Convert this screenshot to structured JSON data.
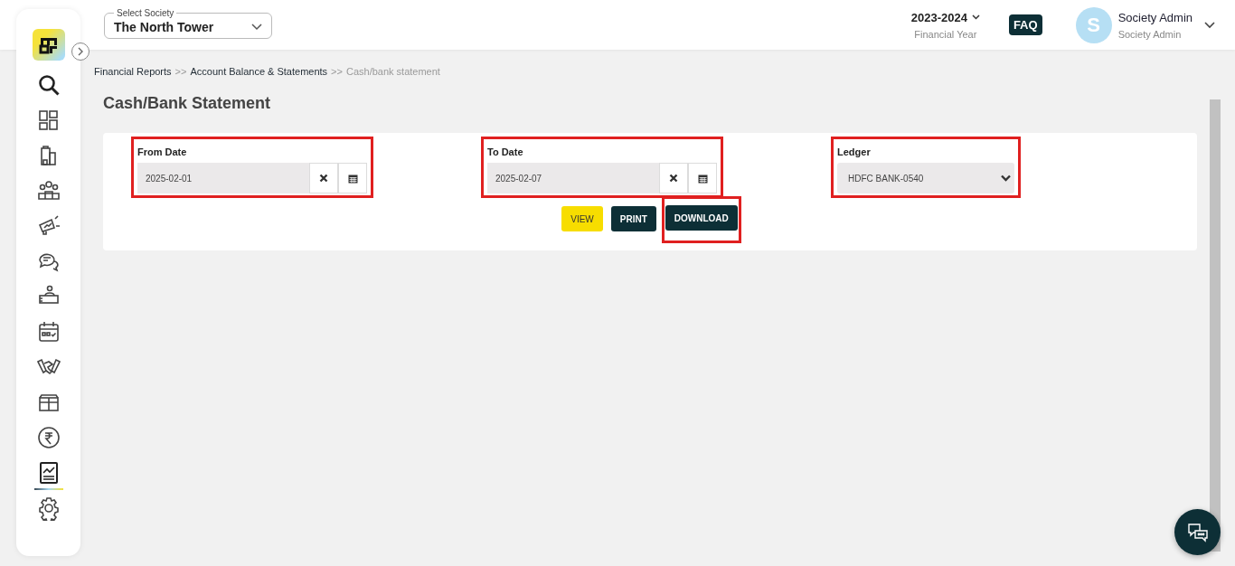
{
  "header": {
    "society_label": "Select Society",
    "society_value": "The North Tower",
    "year": "2023-2024",
    "year_caption": "Financial Year",
    "faq": "FAQ",
    "avatar_letter": "S",
    "user_name": "Society Admin",
    "user_role": "Society Admin"
  },
  "sidebar": {
    "items": [
      {
        "kind": "search",
        "selected": false
      },
      {
        "kind": "dashboard",
        "selected": false
      },
      {
        "kind": "building",
        "selected": false
      },
      {
        "kind": "people",
        "selected": false
      },
      {
        "kind": "megaphone",
        "selected": false
      },
      {
        "kind": "chat",
        "selected": false
      },
      {
        "kind": "desk",
        "selected": false
      },
      {
        "kind": "calendar",
        "selected": false
      },
      {
        "kind": "handshake",
        "selected": false
      },
      {
        "kind": "box",
        "selected": false
      },
      {
        "kind": "rupee",
        "selected": false
      },
      {
        "kind": "report",
        "selected": true
      },
      {
        "kind": "settings",
        "selected": false
      }
    ]
  },
  "breadcrumb": [
    {
      "label": "Financial Reports",
      "current": false
    },
    {
      "label": "Account Balance & Statements",
      "current": false
    },
    {
      "label": "Cash/bank statement",
      "current": true
    }
  ],
  "breadcrumb_separator": ">>",
  "page_title": "Cash/Bank Statement",
  "filters": [
    {
      "kind": "date",
      "label": "From Date",
      "value": "2025-02-01",
      "highlighted": true
    },
    {
      "kind": "date",
      "label": "To Date",
      "value": "2025-02-07",
      "highlighted": true
    },
    {
      "kind": "select",
      "label": "Ledger",
      "value": "HDFC BANK-0540",
      "highlighted": true
    }
  ],
  "buttons": [
    {
      "kind": "primary",
      "label": "VIEW",
      "highlighted": false
    },
    {
      "kind": "dark",
      "label": "PRINT",
      "highlighted": false
    },
    {
      "kind": "dark",
      "label": "DOWNLOAD",
      "highlighted": true
    }
  ]
}
